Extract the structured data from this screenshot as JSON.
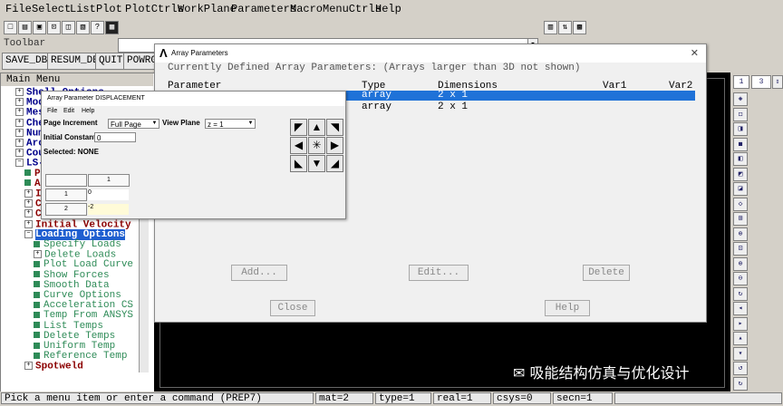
{
  "menubar": [
    "File",
    "Select",
    "List",
    "Plot",
    "PlotCtrls",
    "WorkPlane",
    "Parameters",
    "Macro",
    "MenuCtrls",
    "Help"
  ],
  "toolbar": {
    "label": "Toolbar",
    "buttons": [
      "SAVE_DB",
      "RESUM_DB",
      "QUIT",
      "POWRGRPH"
    ]
  },
  "main_menu": {
    "title": "Main Menu",
    "items": [
      {
        "label": "Shell Options",
        "icon": "expand",
        "cls": "c-dk"
      },
      {
        "label": "Model",
        "icon": "expand",
        "cls": "c-dk"
      },
      {
        "label": "Mesh",
        "icon": "expand",
        "cls": "c-dk"
      },
      {
        "label": "Check",
        "icon": "expand",
        "cls": "c-dk"
      },
      {
        "label": "Numbering",
        "icon": "expand",
        "cls": "c-dk"
      },
      {
        "label": "Archive",
        "icon": "expand",
        "cls": "c-dk"
      },
      {
        "label": "Couple",
        "icon": "expand",
        "cls": "c-dk"
      },
      {
        "label": "LS-DYNA",
        "icon": "collapse",
        "cls": "c-dk"
      },
      {
        "label": "Part",
        "icon": "leaf",
        "cls": "c-red"
      },
      {
        "label": "Assembly",
        "icon": "leaf",
        "cls": "c-red"
      },
      {
        "label": "Iterations",
        "icon": "expand",
        "cls": "c-red"
      },
      {
        "label": "Constraints",
        "icon": "expand",
        "cls": "c-red"
      },
      {
        "label": "Contact",
        "icon": "expand",
        "cls": "c-red"
      },
      {
        "label": "Initial Velocity",
        "icon": "expand",
        "cls": "c-red"
      },
      {
        "label": "Loading Options",
        "icon": "collapse",
        "cls": "c-red sel"
      },
      {
        "label": "Specify Loads",
        "icon": "leaf",
        "cls": "c-grn"
      },
      {
        "label": "Delete Loads",
        "icon": "expand",
        "cls": "c-grn"
      },
      {
        "label": "Plot Load Curve",
        "icon": "leaf",
        "cls": "c-grn"
      },
      {
        "label": "Show Forces",
        "icon": "leaf",
        "cls": "c-grn"
      },
      {
        "label": "Smooth Data",
        "icon": "leaf",
        "cls": "c-grn"
      },
      {
        "label": "Curve Options",
        "icon": "leaf",
        "cls": "c-grn"
      },
      {
        "label": "Acceleration CS",
        "icon": "leaf",
        "cls": "c-grn"
      },
      {
        "label": "Temp From ANSYS",
        "icon": "leaf",
        "cls": "c-grn"
      },
      {
        "label": "List Temps",
        "icon": "leaf",
        "cls": "c-grn"
      },
      {
        "label": "Delete Temps",
        "icon": "leaf",
        "cls": "c-grn"
      },
      {
        "label": "Uniform Temp",
        "icon": "leaf",
        "cls": "c-grn"
      },
      {
        "label": "Reference Temp",
        "icon": "leaf",
        "cls": "c-grn"
      },
      {
        "label": "Spotweld",
        "icon": "expand",
        "cls": "c-red"
      }
    ]
  },
  "array_dialog": {
    "title": "Array Parameters",
    "heading": "Currently Defined Array Parameters: (Arrays larger than 3D not shown)",
    "columns": [
      "Parameter",
      "Type",
      "Dimensions",
      "Var1",
      "Var2"
    ],
    "rows": [
      {
        "param": "",
        "type": "array",
        "dims": "2 x 1"
      },
      {
        "param": "",
        "type": "array",
        "dims": "2 x 1"
      }
    ],
    "buttons": {
      "add": "Add...",
      "edit": "Edit...",
      "delete": "Delete",
      "close": "Close",
      "help": "Help"
    }
  },
  "disp_dialog": {
    "title": "Array Parameter DISPLACEMENT",
    "menu": [
      "File",
      "Edit",
      "Help"
    ],
    "page_increment_label": "Page Increment",
    "page_increment_value": "Full Page",
    "view_plane_label": "View Plane",
    "view_plane_value": "z = 1",
    "initial_constant_label": "Initial Constant",
    "initial_constant_value": "0",
    "selected": "Selected: NONE",
    "col_header": "1",
    "row1": {
      "idx": "1",
      "val": "0"
    },
    "row2": {
      "idx": "2",
      "val": "-2"
    }
  },
  "right_toolbar": {
    "view_number": "1",
    "view_dir": "3"
  },
  "status": {
    "prompt": "Pick a menu item or enter a command (PREP7)",
    "mat": "mat=2",
    "type": "type=1",
    "real": "real=1",
    "csys": "csys=0",
    "secn": "secn=1"
  },
  "watermark": "吸能结构仿真与优化设计"
}
